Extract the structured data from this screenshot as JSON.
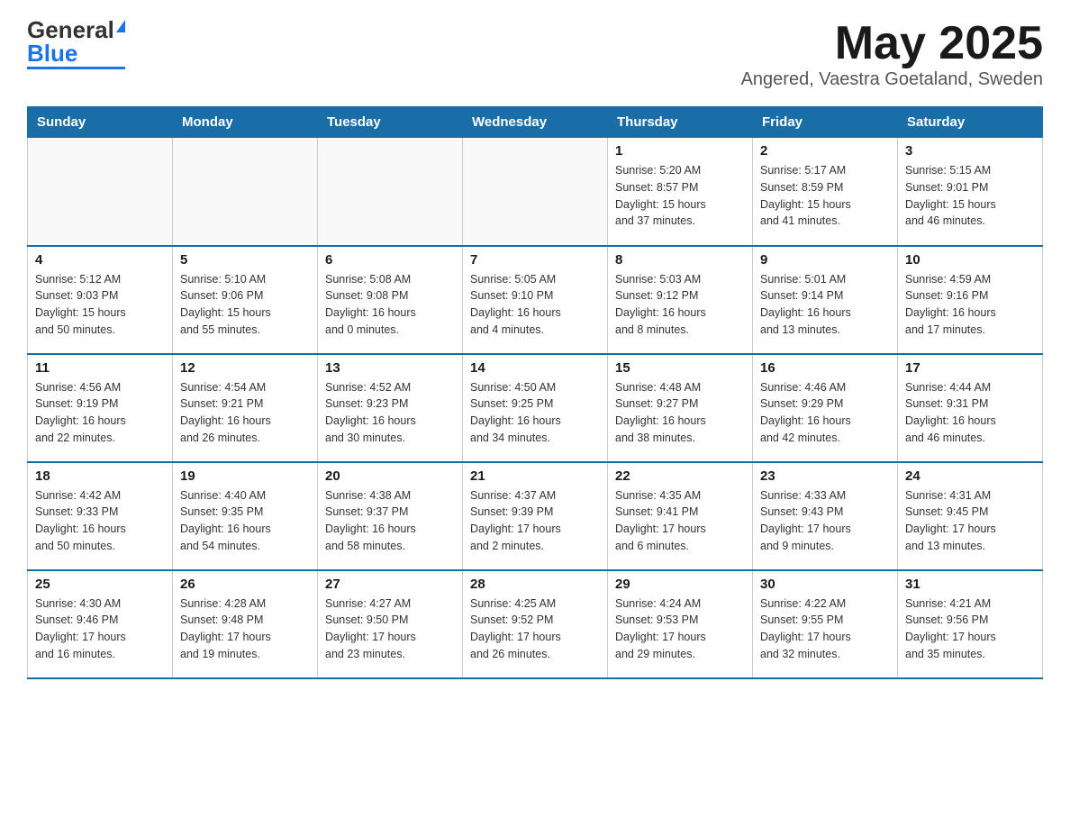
{
  "header": {
    "logo_general": "General",
    "logo_blue": "Blue",
    "month_title": "May 2025",
    "location": "Angered, Vaestra Goetaland, Sweden"
  },
  "days_of_week": [
    "Sunday",
    "Monday",
    "Tuesday",
    "Wednesday",
    "Thursday",
    "Friday",
    "Saturday"
  ],
  "weeks": [
    [
      {
        "day": "",
        "info": ""
      },
      {
        "day": "",
        "info": ""
      },
      {
        "day": "",
        "info": ""
      },
      {
        "day": "",
        "info": ""
      },
      {
        "day": "1",
        "info": "Sunrise: 5:20 AM\nSunset: 8:57 PM\nDaylight: 15 hours\nand 37 minutes."
      },
      {
        "day": "2",
        "info": "Sunrise: 5:17 AM\nSunset: 8:59 PM\nDaylight: 15 hours\nand 41 minutes."
      },
      {
        "day": "3",
        "info": "Sunrise: 5:15 AM\nSunset: 9:01 PM\nDaylight: 15 hours\nand 46 minutes."
      }
    ],
    [
      {
        "day": "4",
        "info": "Sunrise: 5:12 AM\nSunset: 9:03 PM\nDaylight: 15 hours\nand 50 minutes."
      },
      {
        "day": "5",
        "info": "Sunrise: 5:10 AM\nSunset: 9:06 PM\nDaylight: 15 hours\nand 55 minutes."
      },
      {
        "day": "6",
        "info": "Sunrise: 5:08 AM\nSunset: 9:08 PM\nDaylight: 16 hours\nand 0 minutes."
      },
      {
        "day": "7",
        "info": "Sunrise: 5:05 AM\nSunset: 9:10 PM\nDaylight: 16 hours\nand 4 minutes."
      },
      {
        "day": "8",
        "info": "Sunrise: 5:03 AM\nSunset: 9:12 PM\nDaylight: 16 hours\nand 8 minutes."
      },
      {
        "day": "9",
        "info": "Sunrise: 5:01 AM\nSunset: 9:14 PM\nDaylight: 16 hours\nand 13 minutes."
      },
      {
        "day": "10",
        "info": "Sunrise: 4:59 AM\nSunset: 9:16 PM\nDaylight: 16 hours\nand 17 minutes."
      }
    ],
    [
      {
        "day": "11",
        "info": "Sunrise: 4:56 AM\nSunset: 9:19 PM\nDaylight: 16 hours\nand 22 minutes."
      },
      {
        "day": "12",
        "info": "Sunrise: 4:54 AM\nSunset: 9:21 PM\nDaylight: 16 hours\nand 26 minutes."
      },
      {
        "day": "13",
        "info": "Sunrise: 4:52 AM\nSunset: 9:23 PM\nDaylight: 16 hours\nand 30 minutes."
      },
      {
        "day": "14",
        "info": "Sunrise: 4:50 AM\nSunset: 9:25 PM\nDaylight: 16 hours\nand 34 minutes."
      },
      {
        "day": "15",
        "info": "Sunrise: 4:48 AM\nSunset: 9:27 PM\nDaylight: 16 hours\nand 38 minutes."
      },
      {
        "day": "16",
        "info": "Sunrise: 4:46 AM\nSunset: 9:29 PM\nDaylight: 16 hours\nand 42 minutes."
      },
      {
        "day": "17",
        "info": "Sunrise: 4:44 AM\nSunset: 9:31 PM\nDaylight: 16 hours\nand 46 minutes."
      }
    ],
    [
      {
        "day": "18",
        "info": "Sunrise: 4:42 AM\nSunset: 9:33 PM\nDaylight: 16 hours\nand 50 minutes."
      },
      {
        "day": "19",
        "info": "Sunrise: 4:40 AM\nSunset: 9:35 PM\nDaylight: 16 hours\nand 54 minutes."
      },
      {
        "day": "20",
        "info": "Sunrise: 4:38 AM\nSunset: 9:37 PM\nDaylight: 16 hours\nand 58 minutes."
      },
      {
        "day": "21",
        "info": "Sunrise: 4:37 AM\nSunset: 9:39 PM\nDaylight: 17 hours\nand 2 minutes."
      },
      {
        "day": "22",
        "info": "Sunrise: 4:35 AM\nSunset: 9:41 PM\nDaylight: 17 hours\nand 6 minutes."
      },
      {
        "day": "23",
        "info": "Sunrise: 4:33 AM\nSunset: 9:43 PM\nDaylight: 17 hours\nand 9 minutes."
      },
      {
        "day": "24",
        "info": "Sunrise: 4:31 AM\nSunset: 9:45 PM\nDaylight: 17 hours\nand 13 minutes."
      }
    ],
    [
      {
        "day": "25",
        "info": "Sunrise: 4:30 AM\nSunset: 9:46 PM\nDaylight: 17 hours\nand 16 minutes."
      },
      {
        "day": "26",
        "info": "Sunrise: 4:28 AM\nSunset: 9:48 PM\nDaylight: 17 hours\nand 19 minutes."
      },
      {
        "day": "27",
        "info": "Sunrise: 4:27 AM\nSunset: 9:50 PM\nDaylight: 17 hours\nand 23 minutes."
      },
      {
        "day": "28",
        "info": "Sunrise: 4:25 AM\nSunset: 9:52 PM\nDaylight: 17 hours\nand 26 minutes."
      },
      {
        "day": "29",
        "info": "Sunrise: 4:24 AM\nSunset: 9:53 PM\nDaylight: 17 hours\nand 29 minutes."
      },
      {
        "day": "30",
        "info": "Sunrise: 4:22 AM\nSunset: 9:55 PM\nDaylight: 17 hours\nand 32 minutes."
      },
      {
        "day": "31",
        "info": "Sunrise: 4:21 AM\nSunset: 9:56 PM\nDaylight: 17 hours\nand 35 minutes."
      }
    ]
  ]
}
